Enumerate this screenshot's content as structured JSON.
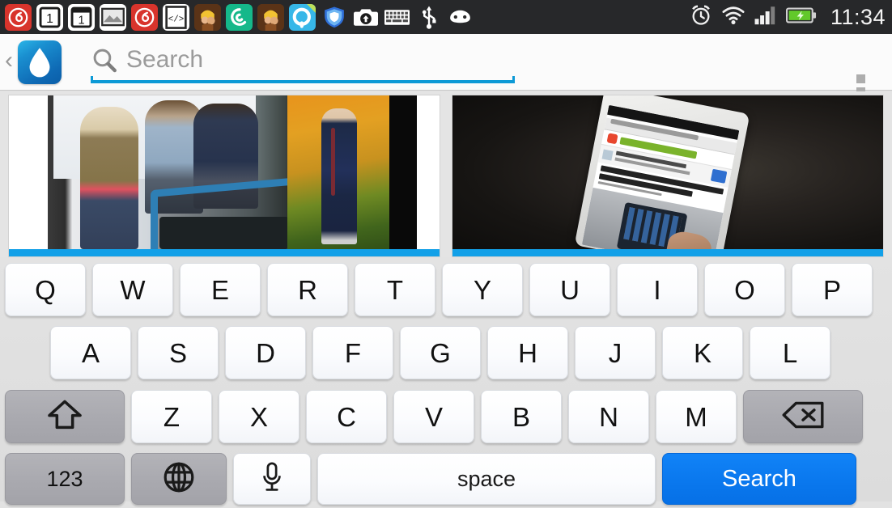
{
  "statusbar": {
    "time": "11:34",
    "notification_icons": [
      {
        "name": "netease-music-icon",
        "glyph": "music"
      },
      {
        "name": "calendar-day-1-icon",
        "glyph": "cal1"
      },
      {
        "name": "calendar-alt-day-1-icon",
        "glyph": "cal2"
      },
      {
        "name": "gallery-image-icon",
        "glyph": "image"
      },
      {
        "name": "netease-music-2-icon",
        "glyph": "music"
      },
      {
        "name": "code-editor-icon",
        "glyph": "code"
      },
      {
        "name": "clash-of-clans-icon",
        "glyph": "coc"
      },
      {
        "name": "qq-browser-icon",
        "glyph": "qgreen"
      },
      {
        "name": "clash-of-clans-2-icon",
        "glyph": "coc"
      },
      {
        "name": "qq-chat-icon",
        "glyph": "qblue"
      },
      {
        "name": "tencent-security-shield-icon",
        "glyph": "shield"
      },
      {
        "name": "upload-camera-icon",
        "glyph": "camera"
      },
      {
        "name": "keyboard-icon",
        "glyph": "keyboard"
      },
      {
        "name": "usb-debugging-icon",
        "glyph": "usb"
      },
      {
        "name": "android-robot-icon",
        "glyph": "android"
      }
    ],
    "system_icons": [
      {
        "name": "alarm-clock-icon"
      },
      {
        "name": "wifi-icon"
      },
      {
        "name": "signal-bars-icon"
      },
      {
        "name": "battery-charging-icon"
      }
    ]
  },
  "header": {
    "back_label": "‹",
    "app_logo_name": "water-drop-app-icon",
    "search_placeholder": "Search",
    "search_value": "",
    "overflow_label": "more-options"
  },
  "results": {
    "items": [
      {
        "name": "image-result-people-bikes",
        "alt": "Three people with a blue bicycle in autumn and a man jogging",
        "selected": true
      },
      {
        "name": "image-result-hand-phone-ubergizmo",
        "alt": "Hand holding an HTC One showing the ubergizmo mobile site",
        "selected": true
      }
    ]
  },
  "keyboard": {
    "rows": [
      {
        "name": "keyboard-row-1",
        "keys": [
          {
            "label": "Q",
            "name": "key-q",
            "type": "letter"
          },
          {
            "label": "W",
            "name": "key-w",
            "type": "letter"
          },
          {
            "label": "E",
            "name": "key-e",
            "type": "letter"
          },
          {
            "label": "R",
            "name": "key-r",
            "type": "letter"
          },
          {
            "label": "T",
            "name": "key-t",
            "type": "letter"
          },
          {
            "label": "Y",
            "name": "key-y",
            "type": "letter"
          },
          {
            "label": "U",
            "name": "key-u",
            "type": "letter"
          },
          {
            "label": "I",
            "name": "key-i",
            "type": "letter"
          },
          {
            "label": "O",
            "name": "key-o",
            "type": "letter"
          },
          {
            "label": "P",
            "name": "key-p",
            "type": "letter"
          }
        ]
      },
      {
        "name": "keyboard-row-2",
        "keys": [
          {
            "label": "A",
            "name": "key-a",
            "type": "letter"
          },
          {
            "label": "S",
            "name": "key-s",
            "type": "letter"
          },
          {
            "label": "D",
            "name": "key-d",
            "type": "letter"
          },
          {
            "label": "F",
            "name": "key-f",
            "type": "letter"
          },
          {
            "label": "G",
            "name": "key-g",
            "type": "letter"
          },
          {
            "label": "H",
            "name": "key-h",
            "type": "letter"
          },
          {
            "label": "J",
            "name": "key-j",
            "type": "letter"
          },
          {
            "label": "K",
            "name": "key-k",
            "type": "letter"
          },
          {
            "label": "L",
            "name": "key-l",
            "type": "letter"
          }
        ]
      },
      {
        "name": "keyboard-row-3",
        "keys": [
          {
            "label": "",
            "name": "key-shift",
            "type": "shift",
            "icon": "shift-arrow-icon"
          },
          {
            "label": "Z",
            "name": "key-z",
            "type": "letter"
          },
          {
            "label": "X",
            "name": "key-x",
            "type": "letter"
          },
          {
            "label": "C",
            "name": "key-c",
            "type": "letter"
          },
          {
            "label": "V",
            "name": "key-v",
            "type": "letter"
          },
          {
            "label": "B",
            "name": "key-b",
            "type": "letter"
          },
          {
            "label": "N",
            "name": "key-n",
            "type": "letter"
          },
          {
            "label": "M",
            "name": "key-m",
            "type": "letter"
          },
          {
            "label": "",
            "name": "key-backspace",
            "type": "backspace",
            "icon": "backspace-icon"
          }
        ]
      },
      {
        "name": "keyboard-row-4",
        "keys": [
          {
            "label": "123",
            "name": "key-numbers",
            "type": "mode"
          },
          {
            "label": "",
            "name": "key-language-globe",
            "type": "globe",
            "icon": "globe-icon"
          },
          {
            "label": "",
            "name": "key-voice-input",
            "type": "mic",
            "icon": "microphone-icon"
          },
          {
            "label": "space",
            "name": "key-space",
            "type": "space"
          },
          {
            "label": "Search",
            "name": "key-search-action",
            "type": "action"
          }
        ]
      }
    ]
  },
  "colors": {
    "accent_blue": "#0d9ad6",
    "selection_bar": "#12a0e8",
    "action_key_blue": "#0a78ee",
    "statusbar_bg": "#27282a",
    "keyboard_bg": "#e0e0e0",
    "key_face": "#fbfcfe",
    "modifier_key": "#a9a9af"
  }
}
